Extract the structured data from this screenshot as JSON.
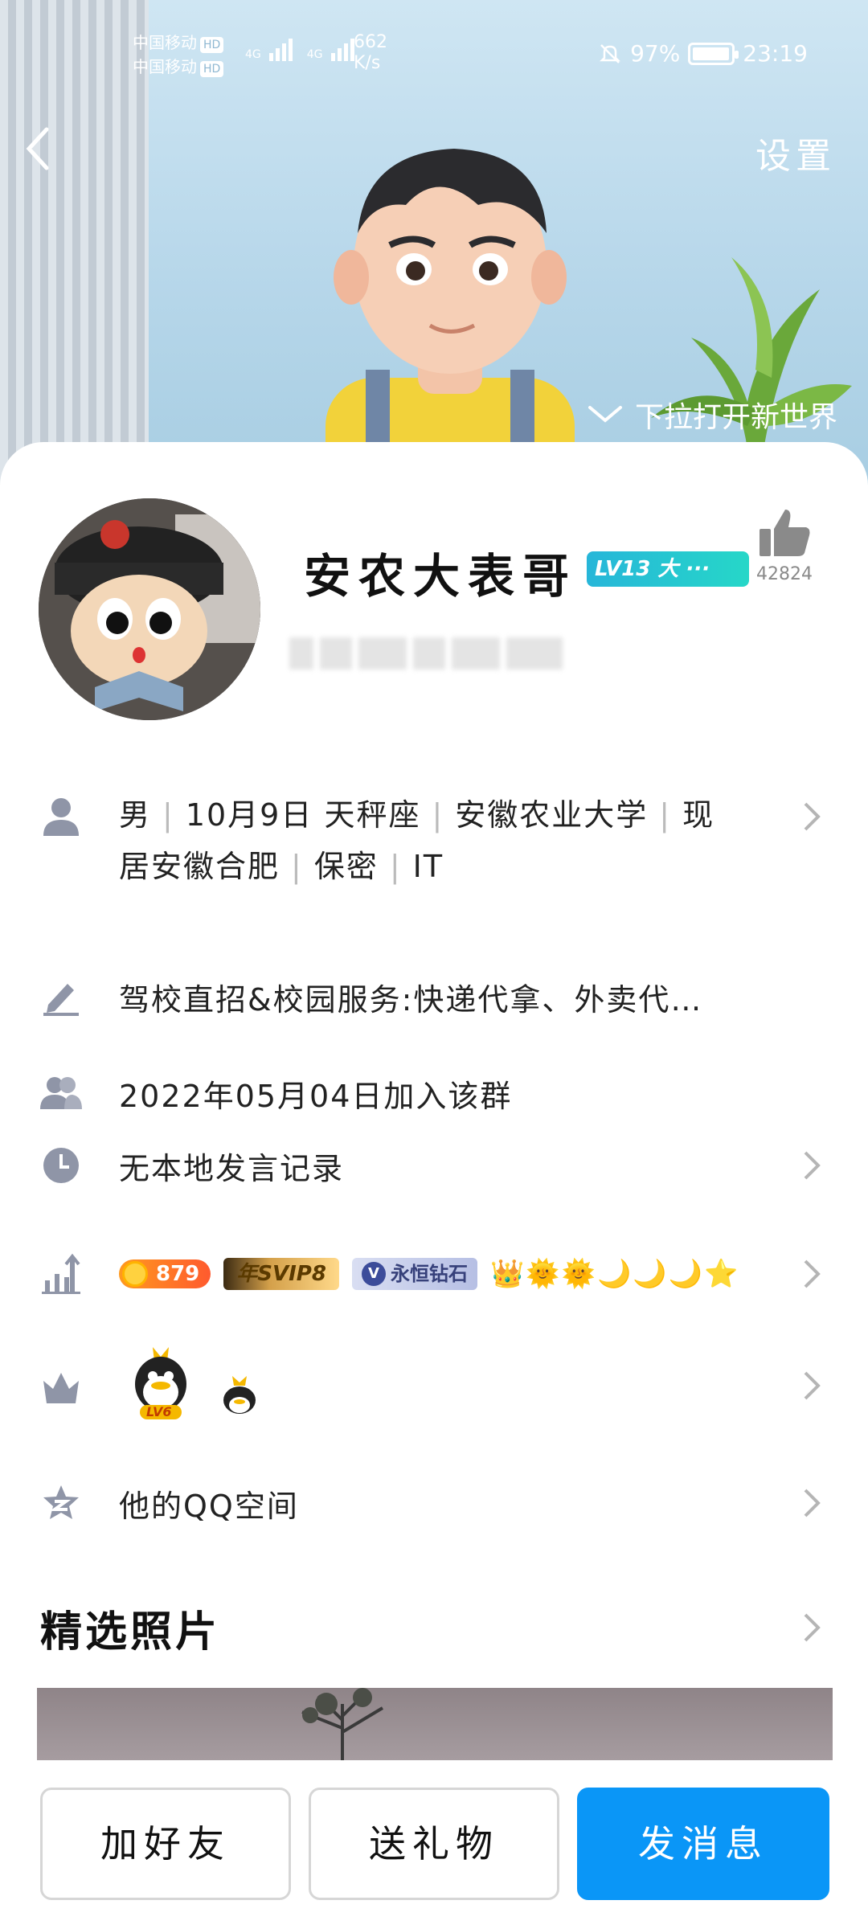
{
  "status_bar": {
    "carrier1": "中国移动",
    "carrier2": "中国移动",
    "hd": "HD",
    "network1": "4G",
    "network2": "4G",
    "speed_value": "662",
    "speed_unit": "K/s",
    "battery_percent": "97%",
    "battery_level": 0.97,
    "time": "23:19"
  },
  "header": {
    "settings_label": "设置",
    "pull_hint": "下拉打开新世界"
  },
  "profile": {
    "nickname": "安农大表哥",
    "level_badge": "LV13 大 ···",
    "like_count": "42824"
  },
  "info": {
    "gender": "男",
    "birthday": "10月9日",
    "constellation": "天秤座",
    "school": "安徽农业大学",
    "location_prefix": "现",
    "location": "居安徽合肥",
    "privacy": "保密",
    "industry": "IT"
  },
  "signature": "驾校直招&校园服务:快递代拿、外卖代…",
  "join_date": "2022年05月04日加入该群",
  "speech_record": "无本地发言记录",
  "vip": {
    "coin_value": "879",
    "svip_label": "年SVIP8",
    "diamond_label": "永恒钻石",
    "diamond_v": "V"
  },
  "qq_level_badge": "LV6",
  "qzone_label": "他的QQ空间",
  "photos_title": "精选照片",
  "actions": {
    "add_friend": "加好友",
    "send_gift": "送礼物",
    "send_message": "发消息"
  },
  "colors": {
    "primary_button": "#0a96f7",
    "level_badge": "#27b6d9",
    "icon_gray": "#8f95a7"
  }
}
